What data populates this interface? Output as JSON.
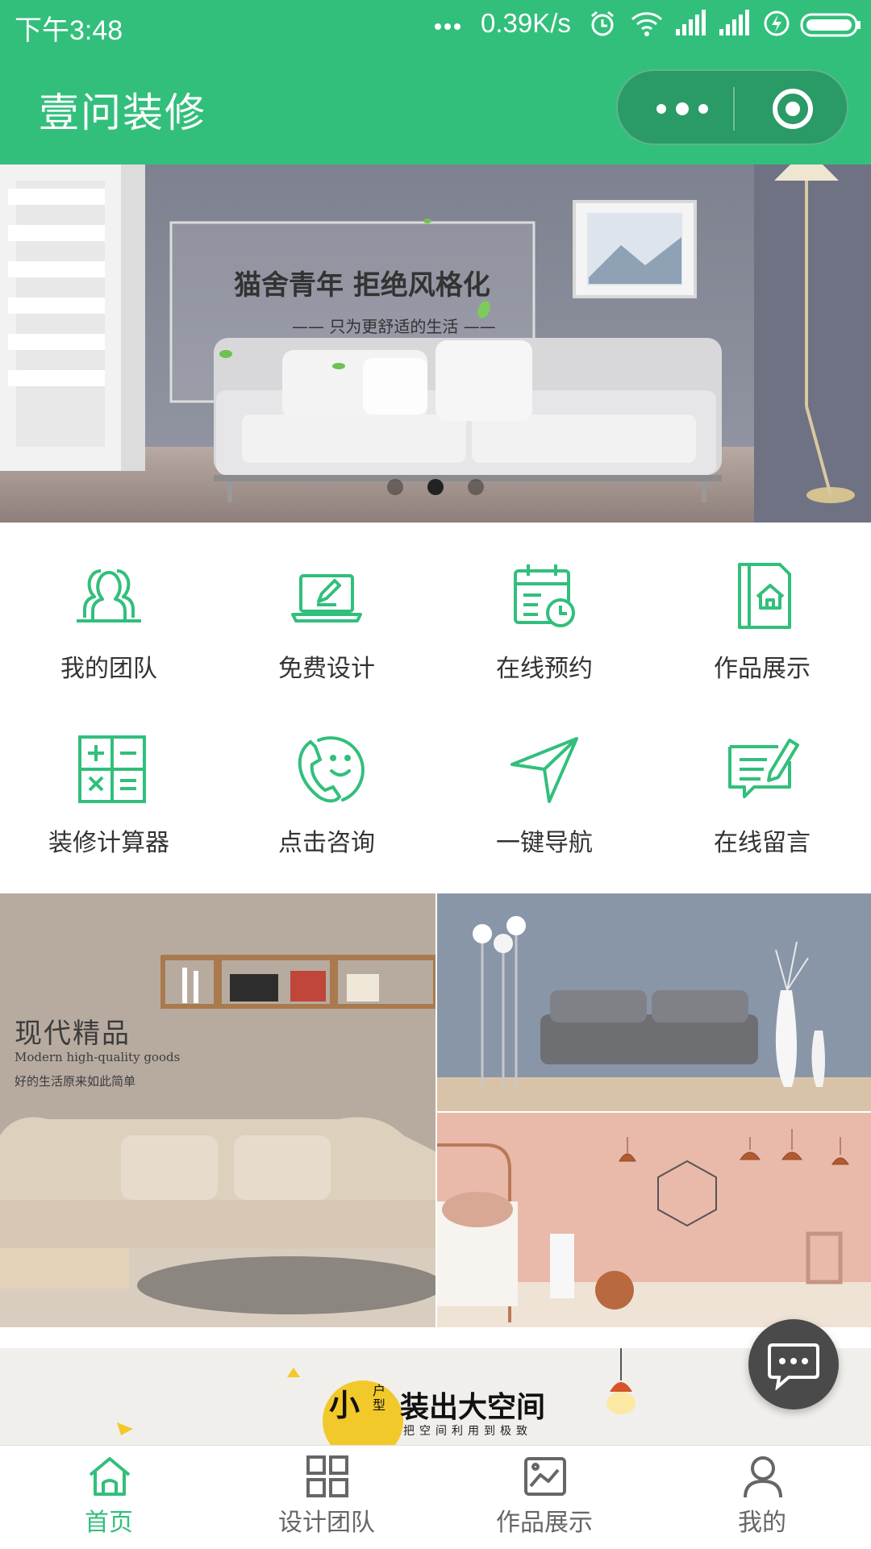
{
  "status_bar": {
    "time": "下午3:48",
    "speed": "0.39K/s",
    "icons": [
      "more-dots-icon",
      "alarm-icon",
      "wifi-icon",
      "signal-icon",
      "signal-icon",
      "charging-icon",
      "battery-icon"
    ]
  },
  "nav": {
    "title": "壹问装修",
    "capsule_icons": [
      "more-icon",
      "close-target-icon"
    ]
  },
  "banner": {
    "title": "猫舍青年  拒绝风格化",
    "subtitle": "—— 只为更舒适的生活 ——",
    "slides": 3,
    "active_slide": 2
  },
  "menu": {
    "items": [
      {
        "label": "我的团队",
        "icon": "team-icon"
      },
      {
        "label": "免费设计",
        "icon": "laptop-design-icon"
      },
      {
        "label": "在线预约",
        "icon": "calendar-clock-icon"
      },
      {
        "label": "作品展示",
        "icon": "portfolio-house-icon"
      },
      {
        "label": "装修计算器",
        "icon": "calculator-icon"
      },
      {
        "label": "点击咨询",
        "icon": "phone-smile-icon"
      },
      {
        "label": "一键导航",
        "icon": "navigation-arrow-icon"
      },
      {
        "label": "在线留言",
        "icon": "message-edit-icon"
      }
    ]
  },
  "promo": {
    "left_title": "现代精品",
    "left_subtitle": "Modern high-quality goods",
    "left_tagline": "好的生活原来如此简单"
  },
  "bottom_banner": {
    "small": "小",
    "type": "户型",
    "main": "装出大空间",
    "sub": "把空间利用到极致"
  },
  "tabbar": {
    "tabs": [
      {
        "label": "首页",
        "icon": "home-icon",
        "active": true
      },
      {
        "label": "设计团队",
        "icon": "grid-icon",
        "active": false
      },
      {
        "label": "作品展示",
        "icon": "gallery-icon",
        "active": false
      },
      {
        "label": "我的",
        "icon": "user-icon",
        "active": false
      }
    ]
  },
  "colors": {
    "brand": "#32bf7c",
    "tab_inactive": "#666666",
    "text": "#333333"
  }
}
